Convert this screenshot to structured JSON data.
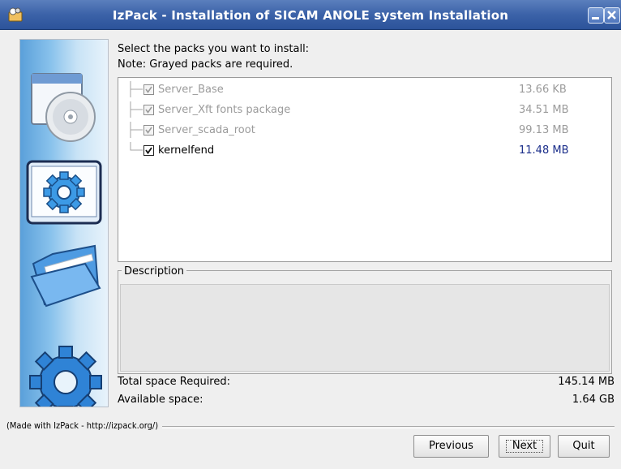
{
  "window": {
    "title": "IzPack - Installation of SICAM ANOLE system Installation",
    "app_icon": "izpack-icon"
  },
  "instructions": {
    "line1": "Select the packs you want to install:",
    "line2": "Note: Grayed packs are required."
  },
  "packs": [
    {
      "name": "Server_Base",
      "size": "13.66 KB",
      "checked": true,
      "required": true
    },
    {
      "name": "Server_Xft fonts package",
      "size": "34.51 MB",
      "checked": true,
      "required": true
    },
    {
      "name": "Server_scada_root",
      "size": "99.13 MB",
      "checked": true,
      "required": true
    },
    {
      "name": "kernelfend",
      "size": "11.48 MB",
      "checked": true,
      "required": false
    }
  ],
  "description": {
    "label": "Description",
    "text": ""
  },
  "space": {
    "required_label": "Total space Required:",
    "required_value": "145.14 MB",
    "available_label": "Available space:",
    "available_value": "1.64 GB"
  },
  "footer": {
    "made_with": "(Made with IzPack - http://izpack.org/)"
  },
  "buttons": {
    "previous": "Previous",
    "next": "Next",
    "quit": "Quit"
  },
  "sidebar": {
    "icons": [
      "cd-installer-icon",
      "settings-gear-icon",
      "folder-icon",
      "large-gear-icon"
    ]
  },
  "colors": {
    "titlebar": "#3b62a8",
    "required_text": "#9b9b9b",
    "size_active": "#1a2d8a"
  }
}
